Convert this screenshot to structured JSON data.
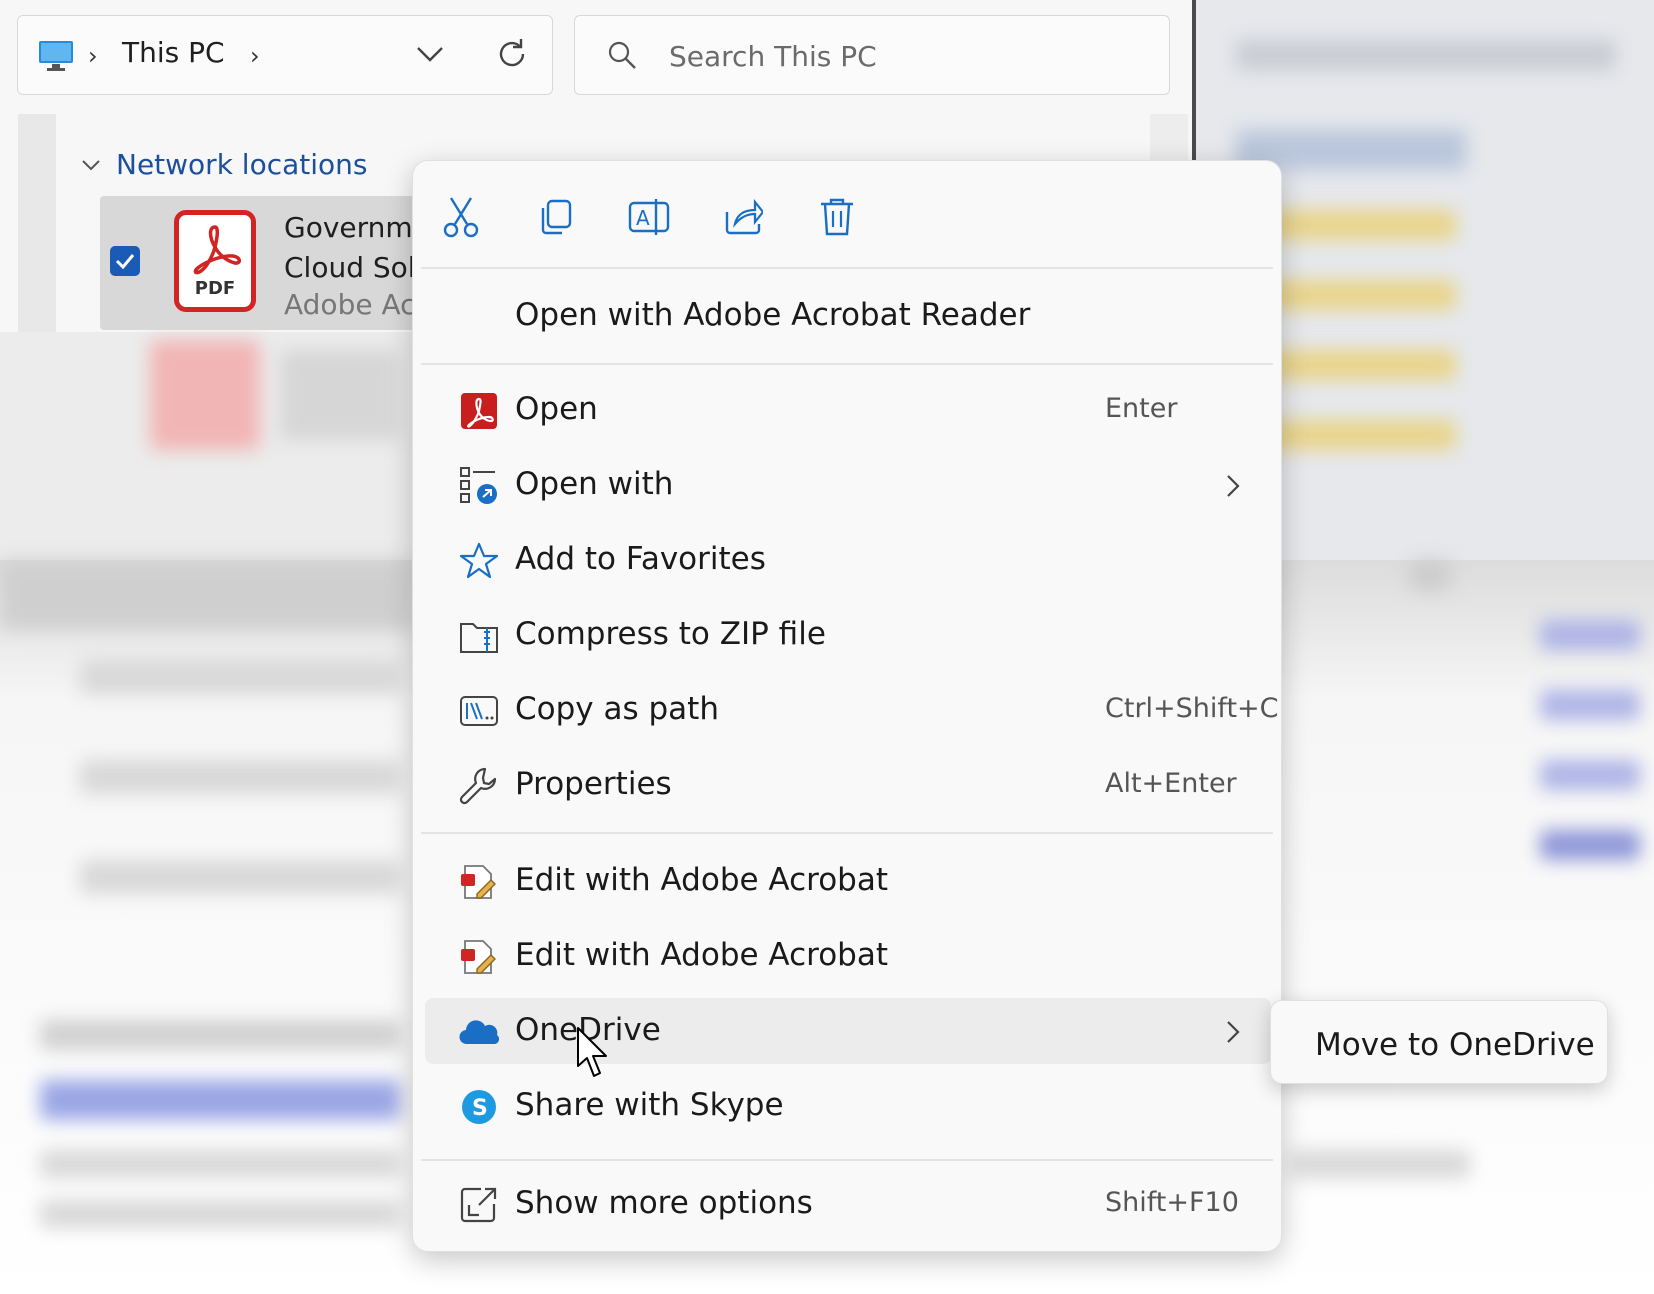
{
  "explorer": {
    "address": {
      "segments": [
        "This PC"
      ]
    },
    "search": {
      "placeholder": "Search This PC"
    },
    "network_section": {
      "label": "Network locations"
    },
    "selected_file": {
      "name_line1": "Governme",
      "name_line2": "Cloud Sol",
      "type": "Adobe Ac",
      "icon_label": "PDF"
    }
  },
  "context_menu": {
    "quick_actions": [
      {
        "name": "cut-icon"
      },
      {
        "name": "copy-icon"
      },
      {
        "name": "rename-icon"
      },
      {
        "name": "share-icon"
      },
      {
        "name": "delete-icon"
      }
    ],
    "default_item": {
      "label": "Open with Adobe Acrobat Reader"
    },
    "items": [
      {
        "label": "Open",
        "accel": "Enter",
        "icon": "acrobat-icon"
      },
      {
        "label": "Open with",
        "accel": "",
        "icon": "open-with-icon",
        "submenu": true
      },
      {
        "label": "Add to Favorites",
        "accel": "",
        "icon": "star-icon"
      },
      {
        "label": "Compress to ZIP file",
        "accel": "",
        "icon": "zip-icon"
      },
      {
        "label": "Copy as path",
        "accel": "Ctrl+Shift+C",
        "icon": "copy-path-icon"
      },
      {
        "label": "Properties",
        "accel": "Alt+Enter",
        "icon": "wrench-icon"
      },
      {
        "label": "Edit with Adobe Acrobat",
        "accel": "",
        "icon": "acrobat-edit-icon"
      },
      {
        "label": "Edit with Adobe Acrobat",
        "accel": "",
        "icon": "acrobat-edit-icon"
      },
      {
        "label": "OneDrive",
        "accel": "",
        "icon": "onedrive-icon",
        "submenu": true
      },
      {
        "label": "Share with Skype",
        "accel": "",
        "icon": "skype-icon"
      },
      {
        "label": "Show more options",
        "accel": "Shift+F10",
        "icon": "more-options-icon"
      }
    ],
    "onedrive_submenu": {
      "label": "Move to OneDrive"
    }
  }
}
